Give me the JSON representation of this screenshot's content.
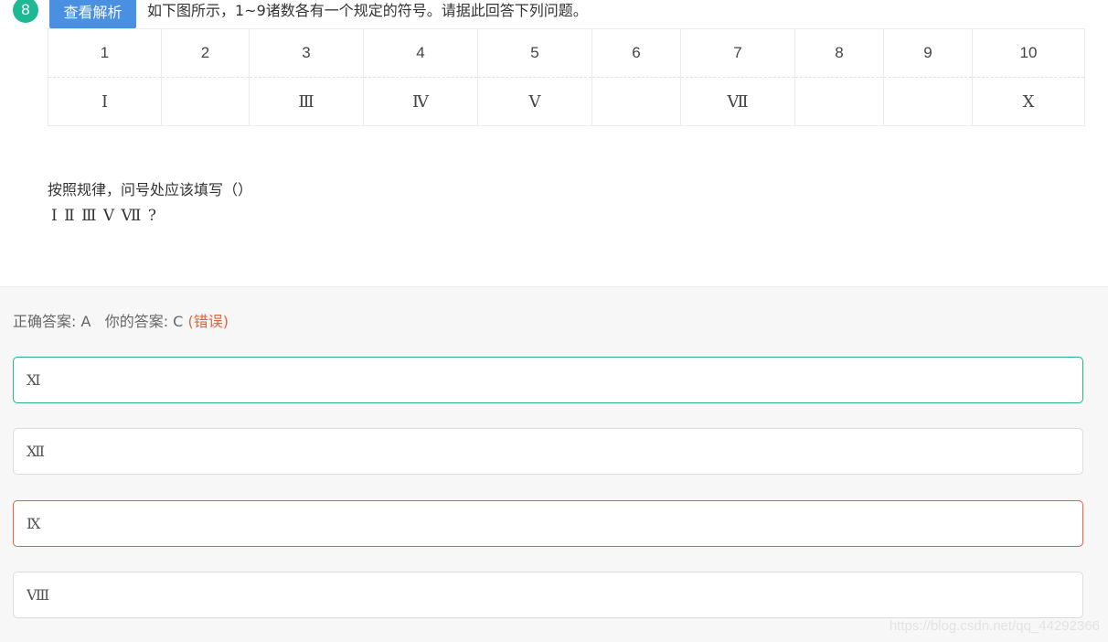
{
  "question": {
    "number": "8",
    "analysis_button": "查看解析",
    "text": "如下图所示，1~9诸数各有一个规定的符号。请据此回答下列问题。"
  },
  "table": {
    "numbers": [
      "1",
      "2",
      "3",
      "4",
      "5",
      "6",
      "7",
      "8",
      "9",
      "10"
    ],
    "symbols": [
      "Ⅰ",
      "",
      "Ⅲ",
      "Ⅳ",
      "Ⅴ",
      "",
      "Ⅶ",
      "",
      "",
      "Ⅹ"
    ]
  },
  "prompt": "按照规律，问号处应该填写（）",
  "sequence": "Ⅰ Ⅱ Ⅲ Ⅴ Ⅶ ?",
  "answer": {
    "correct_label": "正确答案: A",
    "yours_label": "你的答案: C",
    "status": "(错误)"
  },
  "options": [
    {
      "label": "Ⅺ",
      "state": "correct"
    },
    {
      "label": "Ⅻ",
      "state": "normal"
    },
    {
      "label": "Ⅸ",
      "state": "incorrect"
    },
    {
      "label": "Ⅷ",
      "state": "normal"
    }
  ],
  "watermark": "https://blog.csdn.net/qq_44292366",
  "colors": {
    "badge": "#1fb895",
    "button": "#4a90e2",
    "correct_border": "#27b28e",
    "incorrect_border": "#e8623c"
  }
}
